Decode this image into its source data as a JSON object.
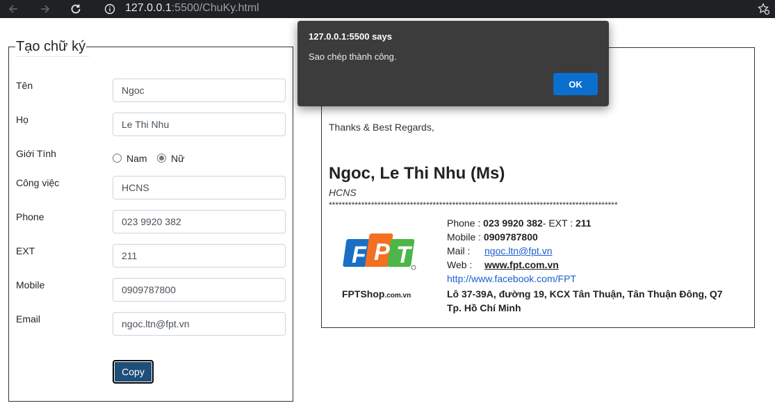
{
  "browser": {
    "url_host": "127.0.0.1",
    "url_rest": ":5500/ChuKy.html"
  },
  "form": {
    "legend": "Tạo chữ ký",
    "fields": {
      "first_name": {
        "label": "Tên",
        "value": "Ngoc"
      },
      "last_name": {
        "label": "Họ",
        "value": "Le Thi Nhu"
      },
      "gender": {
        "label": "Giới Tính",
        "option_male": "Nam",
        "option_female": "Nữ",
        "selected": "Nữ"
      },
      "job": {
        "label": "Công việc",
        "value": "HCNS"
      },
      "phone": {
        "label": "Phone",
        "value": "023 9920 382"
      },
      "ext": {
        "label": "EXT",
        "value": "211"
      },
      "mobile": {
        "label": "Mobile",
        "value": "0909787800"
      },
      "email": {
        "label": "Email",
        "value": "ngoc.ltn@fpt.vn"
      }
    },
    "copy_label": "Copy"
  },
  "signature": {
    "regards": "Thanks & Best Regards,",
    "name": "Ngoc, Le Thi Nhu (Ms)",
    "job": "HCNS",
    "stars": "*****************************************************************************************",
    "logo_text": "FPT",
    "logo_caption_main": "FPTShop",
    "logo_caption_suffix": ".com.vn",
    "phone_label": "Phone : ",
    "phone_value": "023 9920 382",
    "ext_label": "- EXT : ",
    "ext_value": "211",
    "mobile_label": "Mobile : ",
    "mobile_value": "0909787800",
    "mail_label": "Mail :",
    "mail_value": "ngoc.ltn@fpt.vn",
    "web_label": "Web :",
    "web_value": "www.fpt.com.vn",
    "facebook": "http://www.facebook.com/FPT",
    "address": "Lô 37-39A, đường 19, KCX Tân Thuận, Tân Thuận Đông, Q7 Tp. Hồ Chí Minh"
  },
  "dialog": {
    "title": "127.0.0.1:5500 says",
    "message": "Sao chép thành công.",
    "ok_label": "OK"
  },
  "colors": {
    "chrome_bg": "#202124",
    "copy_button_bg": "#1f4e79",
    "dialog_bg": "#3c3c3c",
    "ok_button_bg": "#0b6fd0",
    "fpt_blue": "#1a6fc4",
    "fpt_orange": "#f37021",
    "fpt_green": "#4cb648"
  }
}
